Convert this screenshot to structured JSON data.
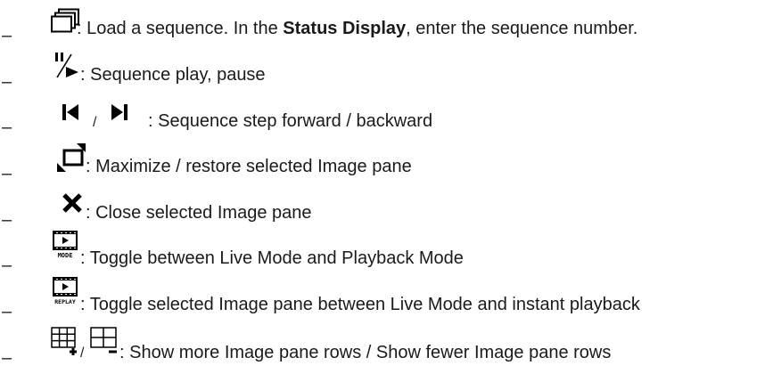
{
  "bullet": "–",
  "items": [
    {
      "icon": "load-sequence-icon",
      "text_before": ": Load a sequence. In the ",
      "text_bold": "Status Display",
      "text_after": ", enter the sequence number."
    },
    {
      "icon": "play-pause-icon",
      "text": ": Sequence play, pause"
    },
    {
      "icons": [
        "step-backward-icon",
        "step-forward-icon"
      ],
      "separator": "/",
      "text": ": Sequence step forward / backward"
    },
    {
      "icon": "maximize-restore-icon",
      "text": ": Maximize / restore selected Image pane"
    },
    {
      "icon": "close-icon",
      "text": ": Close selected Image pane"
    },
    {
      "icon": "mode-film-icon",
      "icon_label": "MODE",
      "text": ": Toggle between Live Mode and Playback Mode"
    },
    {
      "icon": "replay-film-icon",
      "icon_label": "REPLAY",
      "text": ": Toggle selected Image pane between Live Mode and instant playback"
    },
    {
      "icons": [
        "more-rows-icon",
        "fewer-rows-icon"
      ],
      "separator": "/",
      "text": ": Show more Image pane rows / Show fewer Image pane rows"
    }
  ]
}
